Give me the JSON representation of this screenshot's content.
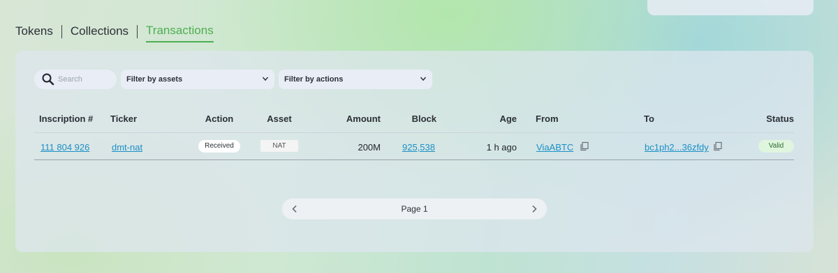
{
  "tabs": [
    {
      "label": "Tokens"
    },
    {
      "label": "Collections"
    },
    {
      "label": "Transactions"
    }
  ],
  "filters": {
    "search_placeholder": "Search",
    "assets_label": "Filter by assets",
    "actions_label": "Filter by actions"
  },
  "table": {
    "headers": {
      "inscription": "Inscription #",
      "ticker": "Ticker",
      "action": "Action",
      "asset": "Asset",
      "amount": "Amount",
      "block": "Block",
      "age": "Age",
      "from": "From",
      "to": "To",
      "status": "Status"
    },
    "rows": [
      {
        "inscription": "111 804 926",
        "ticker": "dmt-nat",
        "action": "Received",
        "asset": "NAT",
        "amount": "200M",
        "block": "925,538",
        "age": "1 h ago",
        "from": "ViaABTC",
        "to": "bc1ph2...36zfdy",
        "status": "Valid"
      }
    ]
  },
  "pagination": {
    "label": "Page 1"
  },
  "colors": {
    "accent": "#4caf50",
    "link": "#1b8fc6",
    "valid_bg": "#dff5de"
  }
}
